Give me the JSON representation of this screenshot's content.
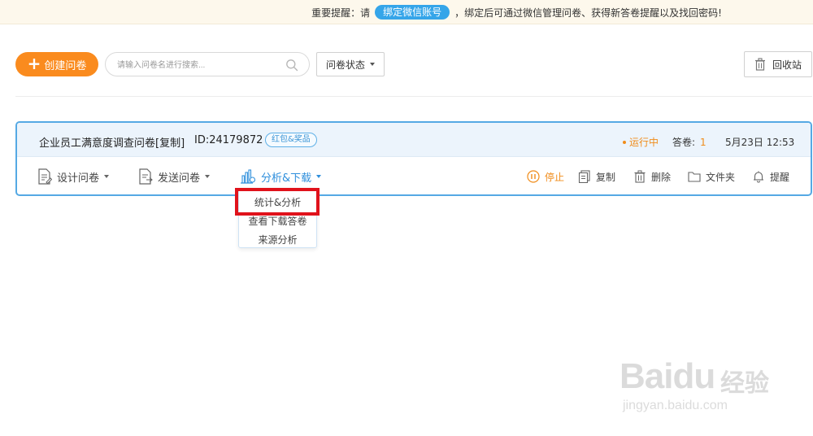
{
  "notice": {
    "prefix": "重要提醒：请",
    "bind_button": "绑定微信账号",
    "suffix": "，绑定后可通过微信管理问卷、获得新答卷提醒以及找回密码!"
  },
  "toolbar": {
    "create_label": "创建问卷",
    "search_placeholder": "请输入问卷名进行搜索...",
    "status_filter": "问卷状态",
    "recycle_label": "回收站"
  },
  "survey": {
    "title": "企业员工满意度调查问卷[复制]",
    "id_text": "ID:24179872",
    "tag": "红包&奖品",
    "status": "运行中",
    "answers_label": "答卷:",
    "answers_count": "1",
    "time": "5月23日 12:53",
    "actions": {
      "design": "设计问卷",
      "send": "发送问卷",
      "analyze": "分析&下载",
      "stop": "停止",
      "copy": "复制",
      "delete": "删除",
      "folder": "文件夹",
      "remind": "提醒"
    }
  },
  "dropdown": {
    "items": [
      "统计&分析",
      "查看下载答卷",
      "来源分析"
    ]
  },
  "watermark": {
    "brand": "Baidu",
    "cn": "经验",
    "url": "jingyan.baidu.com"
  },
  "colors": {
    "accent_orange": "#fa8b1e",
    "accent_blue": "#35a5e9",
    "highlight_red": "#e0121b"
  }
}
